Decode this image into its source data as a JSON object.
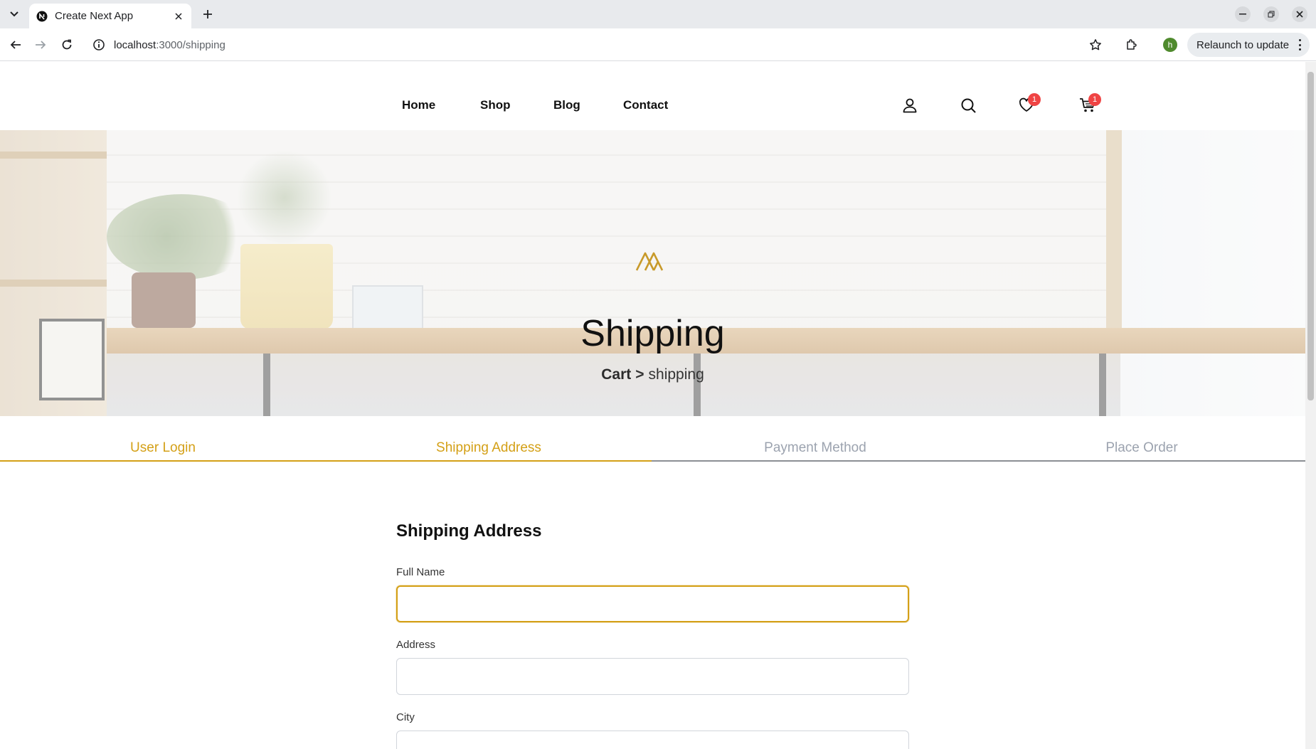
{
  "browser": {
    "tab_title": "Create Next App",
    "url_host": "localhost",
    "url_path": ":3000/shipping",
    "profile_initial": "h",
    "relaunch_label": "Relaunch to update"
  },
  "nav": {
    "links": [
      "Home",
      "Shop",
      "Blog",
      "Contact"
    ],
    "wishlist_count": "1",
    "cart_count": "1",
    "icons": [
      "user-icon",
      "search-icon",
      "heart-icon",
      "cart-icon"
    ]
  },
  "hero": {
    "title": "Shipping",
    "breadcrumb_parent": "Cart",
    "breadcrumb_separator": ">",
    "breadcrumb_current": "shipping"
  },
  "steps": {
    "items": [
      "User Login",
      "Shipping Address",
      "Payment Method",
      "Place Order"
    ],
    "active_count": 2,
    "active_color": "#d4a017",
    "inactive_color": "#9ca3af"
  },
  "form": {
    "title": "Shipping Address",
    "fields": [
      {
        "label": "Full Name",
        "value": ""
      },
      {
        "label": "Address",
        "value": ""
      },
      {
        "label": "City",
        "value": ""
      }
    ]
  },
  "colors": {
    "accent": "#d4a017",
    "badge": "#ef4444"
  }
}
